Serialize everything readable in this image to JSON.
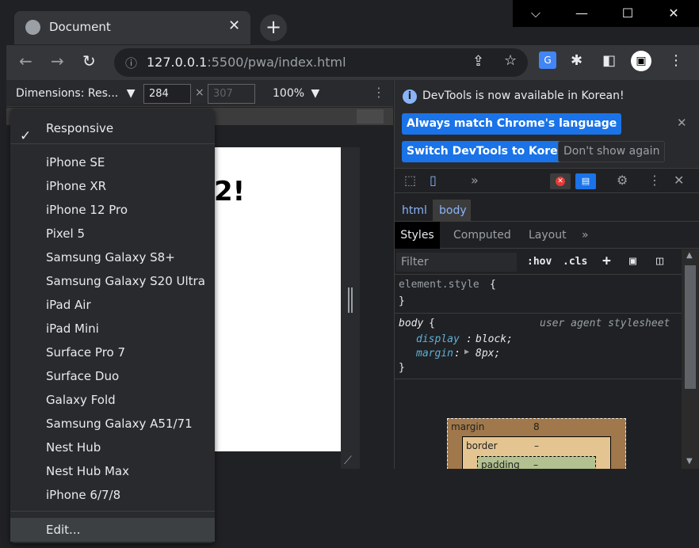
{
  "tab": {
    "title": "Document",
    "close": "✕"
  },
  "window_controls": {
    "dropdown": "⌵",
    "minimize": "—",
    "maximize": "☐",
    "close": "✕"
  },
  "address_bar": {
    "host": "127.0.0.1",
    "path": ":5500/pwa/index.html"
  },
  "device_toolbar": {
    "dimensions_label": "Dimensions: Res...",
    "width": "284",
    "times": "×",
    "height_placeholder": "307",
    "zoom": "100%",
    "more": "⋮"
  },
  "page": {
    "heading": "2!"
  },
  "device_menu": {
    "selected": "Responsive",
    "items": [
      "iPhone SE",
      "iPhone XR",
      "iPhone 12 Pro",
      "Pixel 5",
      "Samsung Galaxy S8+",
      "Samsung Galaxy S20 Ultra",
      "iPad Air",
      "iPad Mini",
      "Surface Pro 7",
      "Surface Duo",
      "Galaxy Fold",
      "Samsung Galaxy A51/71",
      "Nest Hub",
      "Nest Hub Max",
      "iPhone 6/7/8"
    ],
    "edit": "Edit..."
  },
  "devtools": {
    "infobar": {
      "message": "DevTools is now available in Korean!",
      "always_match": "Always match Chrome's language",
      "switch": "Switch DevTools to Korean",
      "dont_show": "Don't show again"
    },
    "breadcrumbs": [
      "html",
      "body"
    ],
    "tabs": [
      "Styles",
      "Computed",
      "Layout"
    ],
    "filter_placeholder": "Filter",
    "hov": ":hov",
    "cls": ".cls",
    "rules": {
      "element_style": "element.style",
      "open_brace": "{",
      "close_brace": "}",
      "body_selector": "body",
      "user_agent": "user agent stylesheet",
      "display_prop": "display",
      "display_val": "block;",
      "margin_prop": "margin",
      "margin_val": "8px;"
    },
    "box_model": {
      "margin_label": "margin",
      "margin_value": "8",
      "border_label": "border",
      "border_value": "–",
      "padding_label": "padding",
      "padding_value": "–"
    }
  }
}
